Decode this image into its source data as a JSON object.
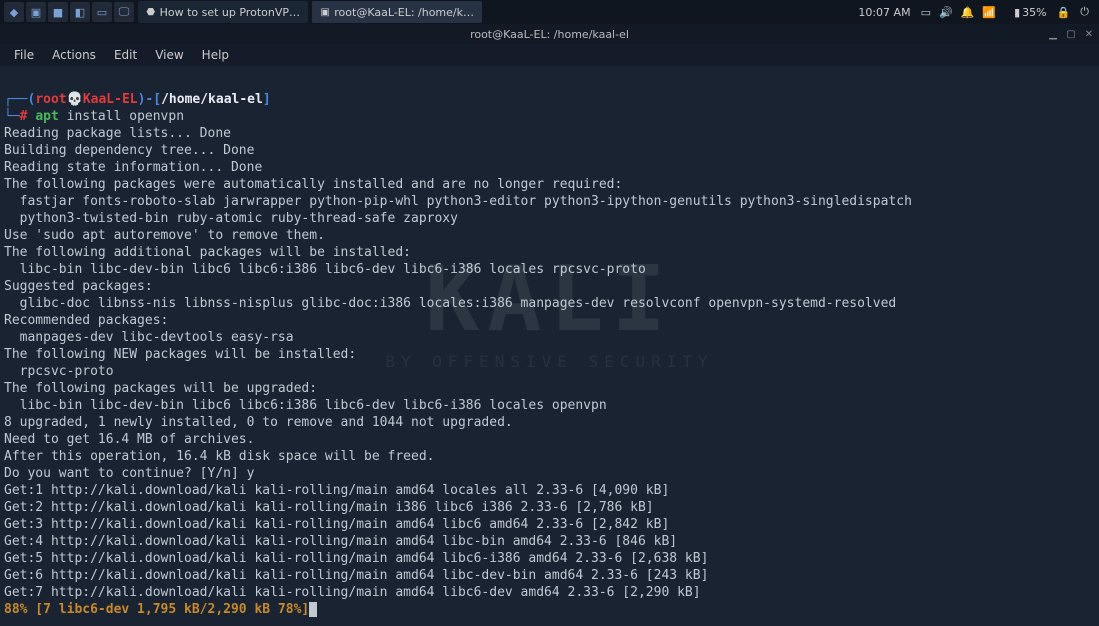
{
  "topbar": {
    "launchers": [
      "◆",
      "▣",
      "■",
      "◧",
      "▭",
      "🖵"
    ],
    "tabs": [
      {
        "icon": "⬣",
        "label": "How to set up ProtonVP…"
      },
      {
        "icon": "▣",
        "label": "root@KaaL-EL: /home/k…"
      }
    ],
    "clock": "10:07 AM",
    "battery": "35%",
    "tray_icons": [
      "▭",
      "🔊",
      "🔔",
      "📶",
      "🔒",
      "⏻"
    ]
  },
  "window": {
    "title": "root@KaaL-EL: /home/kaal-el",
    "controls": [
      "▁",
      "▢",
      "✕"
    ]
  },
  "menubar": [
    "File",
    "Actions",
    "Edit",
    "View",
    "Help"
  ],
  "prompt": {
    "open": "┌──(",
    "user": "root",
    "skull": "💀",
    "host": "KaaL-EL",
    "close": ")-[",
    "path": "/home/kaal-el",
    "end": "]",
    "line2_prefix": "└─",
    "hash": "#",
    "cmd_bin": "apt",
    "cmd_args": " install openvpn"
  },
  "output": [
    "Reading package lists... Done",
    "Building dependency tree... Done",
    "Reading state information... Done",
    "The following packages were automatically installed and are no longer required:",
    "  fastjar fonts-roboto-slab jarwrapper python-pip-whl python3-editor python3-ipython-genutils python3-singledispatch",
    "  python3-twisted-bin ruby-atomic ruby-thread-safe zaproxy",
    "Use 'sudo apt autoremove' to remove them.",
    "The following additional packages will be installed:",
    "  libc-bin libc-dev-bin libc6 libc6:i386 libc6-dev libc6-i386 locales rpcsvc-proto",
    "Suggested packages:",
    "  glibc-doc libnss-nis libnss-nisplus glibc-doc:i386 locales:i386 manpages-dev resolvconf openvpn-systemd-resolved",
    "Recommended packages:",
    "  manpages-dev libc-devtools easy-rsa",
    "The following NEW packages will be installed:",
    "  rpcsvc-proto",
    "The following packages will be upgraded:",
    "  libc-bin libc-dev-bin libc6 libc6:i386 libc6-dev libc6-i386 locales openvpn",
    "8 upgraded, 1 newly installed, 0 to remove and 1044 not upgraded.",
    "Need to get 16.4 MB of archives.",
    "After this operation, 16.4 kB disk space will be freed.",
    "Do you want to continue? [Y/n] y",
    "Get:1 http://kali.download/kali kali-rolling/main amd64 locales all 2.33-6 [4,090 kB]",
    "Get:2 http://kali.download/kali kali-rolling/main i386 libc6 i386 2.33-6 [2,786 kB]",
    "Get:3 http://kali.download/kali kali-rolling/main amd64 libc6 amd64 2.33-6 [2,842 kB]",
    "Get:4 http://kali.download/kali kali-rolling/main amd64 libc-bin amd64 2.33-6 [846 kB]",
    "Get:5 http://kali.download/kali kali-rolling/main amd64 libc6-i386 amd64 2.33-6 [2,638 kB]",
    "Get:6 http://kali.download/kali kali-rolling/main amd64 libc-dev-bin amd64 2.33-6 [243 kB]",
    "Get:7 http://kali.download/kali kali-rolling/main amd64 libc6-dev amd64 2.33-6 [2,290 kB]"
  ],
  "progress": "88% [7 libc6-dev 1,795 kB/2,290 kB 78%]",
  "watermark": {
    "brand": "KALI",
    "tag": "BY OFFENSIVE SECURITY"
  }
}
